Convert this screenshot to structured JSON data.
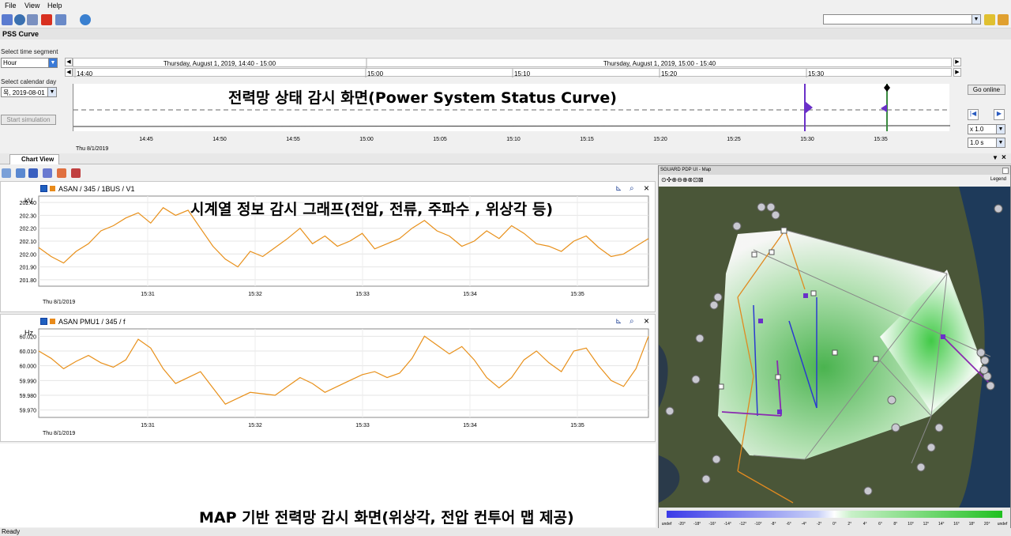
{
  "menu": {
    "file": "File",
    "view": "View",
    "help": "Help"
  },
  "pss": {
    "title": "PSS Curve",
    "time_segment_label": "Select time segment",
    "time_segment_value": "Hour",
    "calendar_label": "Select calendar day",
    "calendar_value": "목, 2019-08-01",
    "start_sim": "Start simulation",
    "go_online": "Go online",
    "speed": "x 1.0",
    "interval": "1.0 s",
    "timeline_left": "Thursday, August 1, 2019, 14:40 - 15:00",
    "timeline_right": "Thursday, August 1, 2019, 15:00 - 15:40",
    "sub_ticks": [
      "14:40",
      "15:00",
      "15:10",
      "15:20",
      "15:30"
    ],
    "axis_ticks": [
      "14:45",
      "14:50",
      "14:55",
      "15:00",
      "15:05",
      "15:10",
      "15:15",
      "15:20",
      "15:25",
      "15:30",
      "15:35"
    ],
    "date": "Thu 8/1/2019"
  },
  "annotations": {
    "pss": "전력망 상태 감시 화면(Power System Status Curve)",
    "timeseries": "시계열 정보 감시 그래프(전압, 전류, 주파수 , 위상각 등)",
    "map": "MAP 기반 전력망 감시 화면(위상각, 전압 컨투어 맵 제공)"
  },
  "chart_view": {
    "tab": "Chart View",
    "panel1": {
      "title": "ASAN / 345 / 1BUS / V1",
      "unit": "kV",
      "date": "Thu 8/1/2019"
    },
    "panel2": {
      "title": "ASAN PMU1 / 345 / f",
      "unit": "Hz",
      "date": "Thu 8/1/2019"
    }
  },
  "chart_data": [
    {
      "type": "line",
      "title": "ASAN / 345 / 1BUS / V1",
      "ylabel": "kV",
      "ylim": [
        201.75,
        202.45
      ],
      "yticks": [
        "202.40",
        "202.30",
        "202.20",
        "202.10",
        "202.00",
        "201.90",
        "201.80"
      ],
      "xticks": [
        "15:31",
        "15:32",
        "15:33",
        "15:34",
        "15:35"
      ],
      "series": [
        {
          "color": "#e8901a",
          "values": [
            202.05,
            201.98,
            201.93,
            202.02,
            202.08,
            202.18,
            202.22,
            202.28,
            202.32,
            202.24,
            202.36,
            202.3,
            202.34,
            202.2,
            202.06,
            201.96,
            201.9,
            202.02,
            201.98,
            202.05,
            202.12,
            202.2,
            202.08,
            202.14,
            202.06,
            202.1,
            202.16,
            202.04,
            202.08,
            202.12,
            202.2,
            202.26,
            202.18,
            202.14,
            202.06,
            202.1,
            202.18,
            202.12,
            202.22,
            202.16,
            202.08,
            202.06,
            202.02,
            202.1,
            202.14,
            202.05,
            201.98,
            202.0,
            202.06,
            202.12
          ]
        }
      ]
    },
    {
      "type": "line",
      "title": "ASAN PMU1 / 345 / f",
      "ylabel": "Hz",
      "ylim": [
        59.965,
        60.025
      ],
      "yticks": [
        "60.020",
        "60.010",
        "60.000",
        "59.990",
        "59.980",
        "59.970"
      ],
      "xticks": [
        "15:31",
        "15:32",
        "15:33",
        "15:34",
        "15:35"
      ],
      "series": [
        {
          "color": "#e8901a",
          "values": [
            60.01,
            60.005,
            59.998,
            60.003,
            60.007,
            60.002,
            59.999,
            60.004,
            60.018,
            60.012,
            59.998,
            59.988,
            59.992,
            59.996,
            59.985,
            59.974,
            59.978,
            59.982,
            59.981,
            59.98,
            59.986,
            59.992,
            59.988,
            59.982,
            59.986,
            59.99,
            59.994,
            59.996,
            59.992,
            59.995,
            60.005,
            60.02,
            60.014,
            60.008,
            60.013,
            60.004,
            59.992,
            59.985,
            59.992,
            60.004,
            60.01,
            60.002,
            59.996,
            60.01,
            60.012,
            60.0,
            59.99,
            59.986,
            59.998,
            60.02
          ]
        }
      ]
    }
  ],
  "map": {
    "title": "SGUARD PDP UI - Map",
    "legend": "Legend",
    "scale_labels": [
      "undef",
      "-20°",
      "-18°",
      "-16°",
      "-14°",
      "-12°",
      "-10°",
      "-8°",
      "-6°",
      "-4°",
      "-2°",
      "0°",
      "2°",
      "4°",
      "6°",
      "8°",
      "10°",
      "12°",
      "14°",
      "16°",
      "18°",
      "20°",
      "undef"
    ]
  },
  "status": "Ready"
}
